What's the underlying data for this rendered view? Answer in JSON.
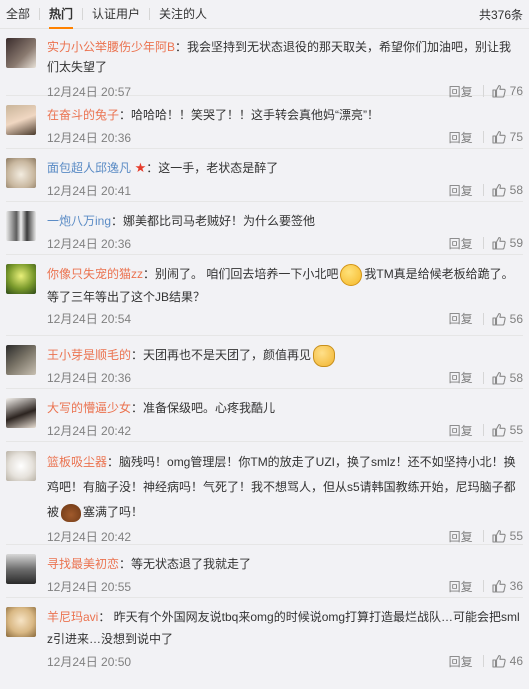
{
  "tabs": [
    "全部",
    "热门",
    "认证用户",
    "关注的人"
  ],
  "total": "共376条",
  "reply_label": "回复",
  "comments": [
    {
      "name": "实力小公举腰伤少年阿B",
      "text": "：我会坚持到无状态退役的那天取关，希望你们加油吧，别让我们太失望了",
      "time": "12月24日 20:57",
      "likes": "76"
    },
    {
      "name": "在奋斗的兔子",
      "text": "：哈哈哈！！笑哭了！！这手转会真他妈“漂亮”！",
      "time": "12月24日 20:36",
      "likes": "75"
    },
    {
      "name": "面包超人邱逸凡",
      "text": "：这一手，老状态是醉了",
      "time": "12月24日 20:41",
      "likes": "58"
    },
    {
      "name": "一炮八万ing",
      "text": "：娜美都比司马老贼好！为什么要签他",
      "time": "12月24日 20:36",
      "likes": "59"
    },
    {
      "name": "你像只失宠的猫zz",
      "text_a": "：别闹了。 咱们回去培养一下小北吧",
      "text_b": "我TM真是给候老板给跪了。等了三年等出了这个JB结果？",
      "time": "12月24日 20:54",
      "likes": "56"
    },
    {
      "name": "王小芽是顺毛的",
      "text": "：天团再也不是天团了，颜值再见",
      "time": "12月24日 20:36",
      "likes": "58"
    },
    {
      "name": "大写的懵逼少女",
      "text": "：准备保级吧。心疼我酷儿",
      "time": "12月24日 20:42",
      "likes": "55"
    },
    {
      "name": "篮板吸尘器",
      "text_a": "：脑残吗！omg管理层！你TM的放走了UZI，换了smlz！还不如坚持小北！换鸡吧！有脑子没！神经病吗！气死了！我不想骂人，但从s5请韩国教练开始，尼玛脑子都被",
      "text_b": "塞满了吗！",
      "time": "12月24日 20:42",
      "likes": "55"
    },
    {
      "name": "寻找最美初恋",
      "text": "：等无状态退了我就走了",
      "time": "12月24日 20:55",
      "likes": "36"
    },
    {
      "name": "羊尼玛avi",
      "text": "： 昨天有个外国网友说tbq来omg的时候说omg打算打造最烂战队…可能会把smlz引进来…没想到说中了",
      "time": "12月24日 20:50",
      "likes": "46"
    }
  ]
}
